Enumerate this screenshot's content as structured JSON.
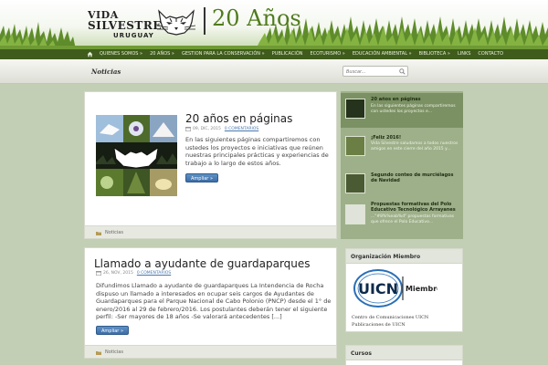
{
  "header": {
    "logo_line1": "VIDA",
    "logo_line2": "SILVESTRE",
    "logo_line3": "URUGUAY",
    "years": "20 Años"
  },
  "nav": {
    "items": [
      "QUIENES SOMOS »",
      "20 AÑOS »",
      "GESTION PARA LA CONSERVACIÓN »",
      "PUBLICACIÓN",
      "ECOTURISMO »",
      "EDUCACIÓN AMBIENTAL »",
      "BIBLIOTECA »",
      "LINKS",
      "CONTACTO"
    ]
  },
  "subbar": {
    "title": "Noticias",
    "search_placeholder": "Buscar..."
  },
  "posts": [
    {
      "title": "20 años en páginas",
      "date": "09, DIC, 2015",
      "comments": "0 COMENTARIOS",
      "excerpt": "En las siguientes páginas compartiremos con ustedes los proyectos e iniciativas que reúnen nuestras principales prácticas y experiencias de trabajo a lo largo de estos años.",
      "read_more": "Ampliar »",
      "category": "Noticias"
    },
    {
      "title": "Llamado a ayudante de guardaparques",
      "date": "26, NOV, 2015",
      "comments": "0 COMENTARIOS",
      "excerpt": "Difundimos Llamado a ayudante de guardaparques La Intendencia de Rocha dispuso un llamado a interesados en ocupar seis cargos de Ayudantes de Guardaparques para el Parque Nacional de Cabo Polonio (PNCP) desde el 1° de enero/2016 al 29 de febrero/2016. Los postulantes deberán tener el siguiente perfil: -Ser mayores de 18 años -Se valorará antecedentes [...]",
      "read_more": "Ampliar »",
      "category": "Noticias"
    }
  ],
  "featured": [
    {
      "title": "20 años en páginas",
      "desc": "En las siguientes páginas compartiremos con ustedes los proyectos e..."
    },
    {
      "title": "¡Feliz 2016!",
      "desc": "Vida Silvestre saludamos a todos nuestros amigos en este cierre del año 2015 y..."
    },
    {
      "title": "Segundo conteo de murciélagos de Navidad",
      "desc": ""
    },
    {
      "title": "Propuestas formativas del Polo Educativo Tecnológico Arrayanes",
      "desc": "...\"#8%%eab%d\" propuestas formativas que ofrece el Polo Educativo..."
    }
  ],
  "widgets": {
    "org_title": "Organización Miembro",
    "uicn_text": "UICN",
    "uicn_member": "Miembro",
    "org_links": [
      "Centro de Comunicaciones UICN",
      "Publicaciones de UICN"
    ],
    "cursos_title": "Cursos"
  },
  "colors": {
    "nav_bg": "#3f5c1c",
    "accent_green": "#4f7b1d",
    "sidebar_bg": "#9eb08a",
    "button_blue": "#4a7fb8"
  }
}
